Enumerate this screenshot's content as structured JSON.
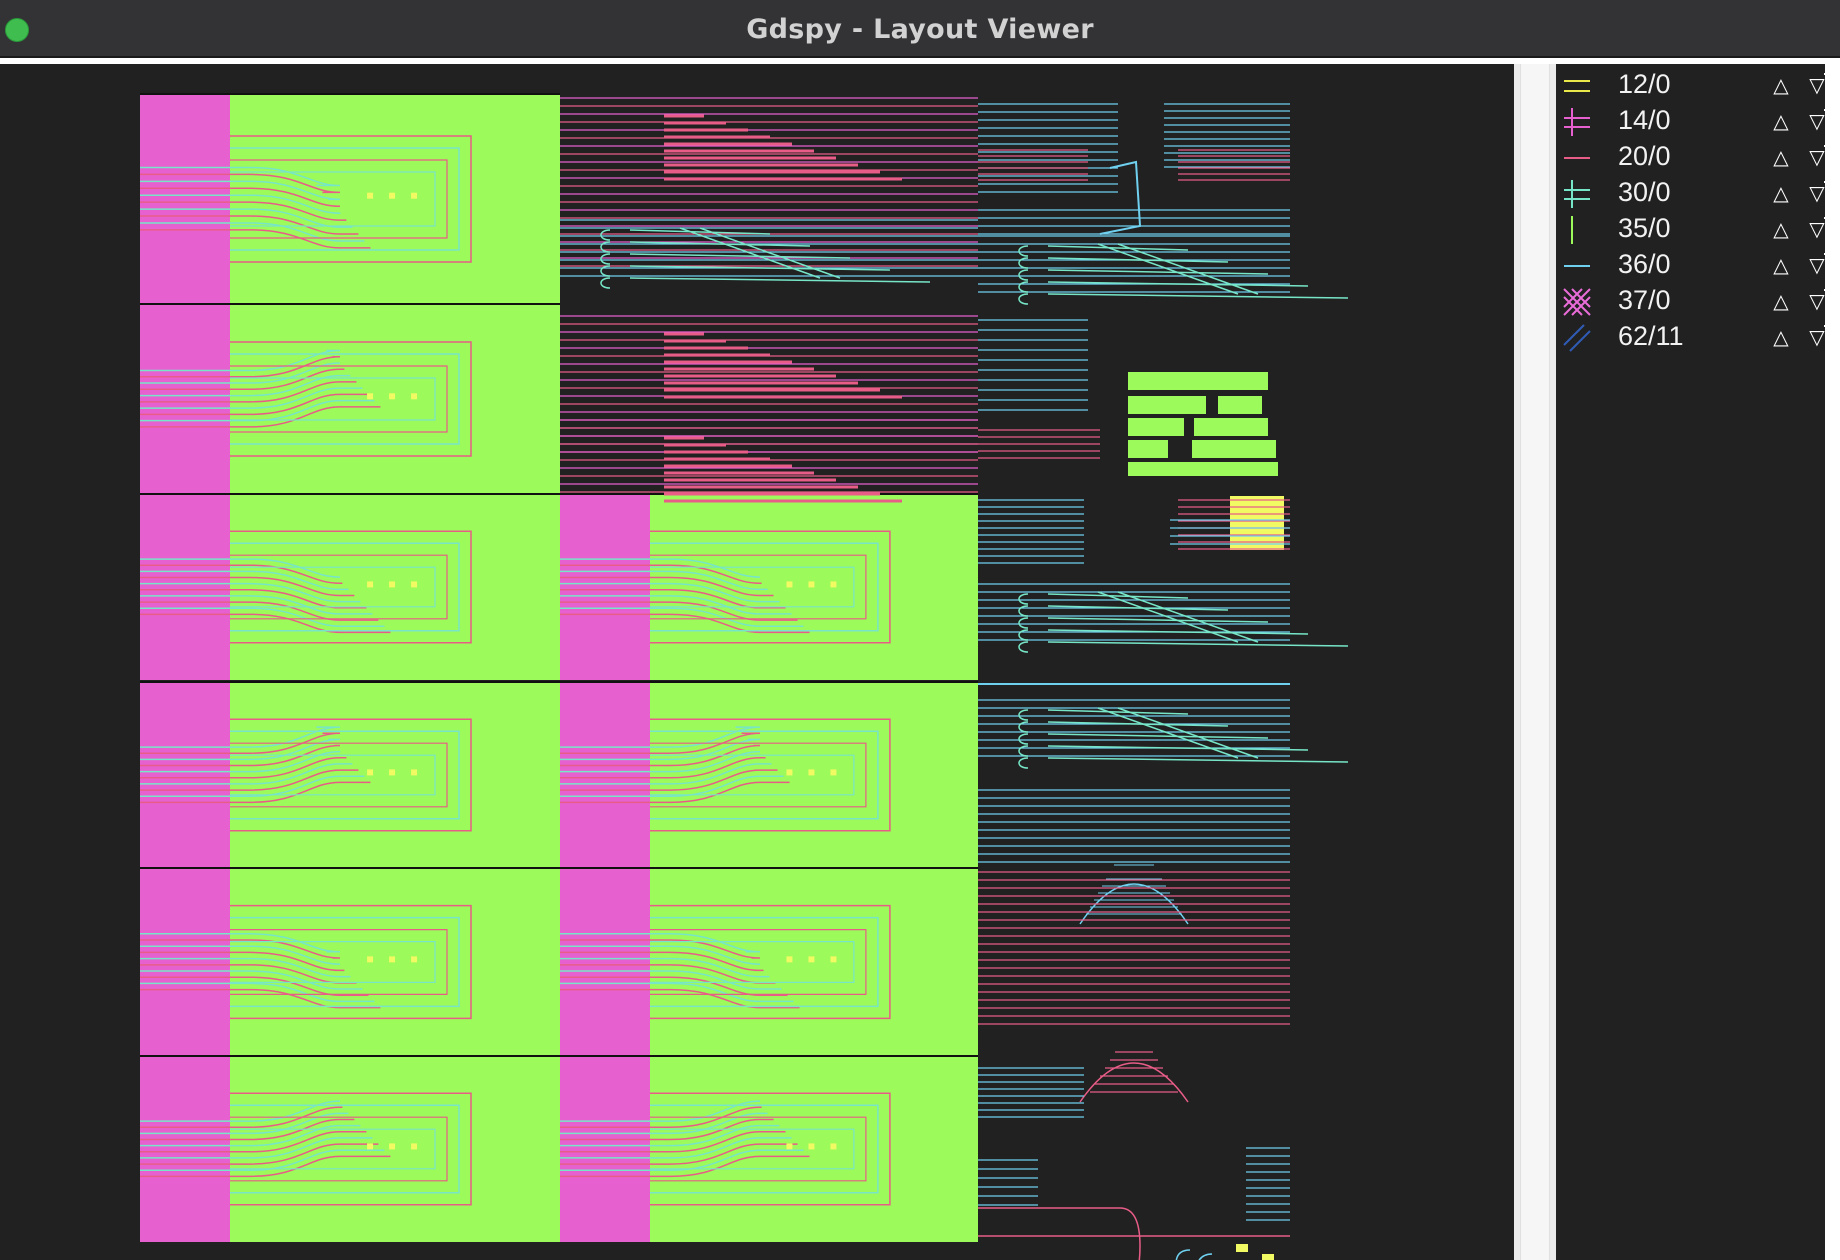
{
  "window": {
    "title": "Gdspy - Layout Viewer"
  },
  "colors": {
    "background": "#212121",
    "layer_12_0": "#e8e84a",
    "layer_14_0": "#e760d0",
    "layer_20_0": "#e85d88",
    "layer_30_0": "#77e6c8",
    "layer_35_0": "#9cfa5a",
    "layer_36_0": "#6fd0ef",
    "layer_37_0": "#ea6cd9",
    "layer_62_11": "#2f5bb5",
    "pad_yellow": "#f1fa62"
  },
  "layers": [
    {
      "name": "12/0",
      "icon": "hline-icon",
      "color": "#e8e84a"
    },
    {
      "name": "14/0",
      "icon": "hash-icon",
      "color": "#e760d0"
    },
    {
      "name": "20/0",
      "icon": "hline-icon",
      "color": "#e85d88"
    },
    {
      "name": "30/0",
      "icon": "hash-icon",
      "color": "#77e6c8"
    },
    {
      "name": "35/0",
      "icon": "vline-icon",
      "color": "#9cfa5a"
    },
    {
      "name": "36/0",
      "icon": "hline-icon",
      "color": "#6fd0ef"
    },
    {
      "name": "37/0",
      "icon": "crosshatch-icon",
      "color": "#ea6cd9"
    },
    {
      "name": "62/11",
      "icon": "diagonal-hatch-icon",
      "color": "#2f5bb5"
    }
  ],
  "controls": {
    "up_glyph": "▲",
    "down_glyph": "▽"
  }
}
